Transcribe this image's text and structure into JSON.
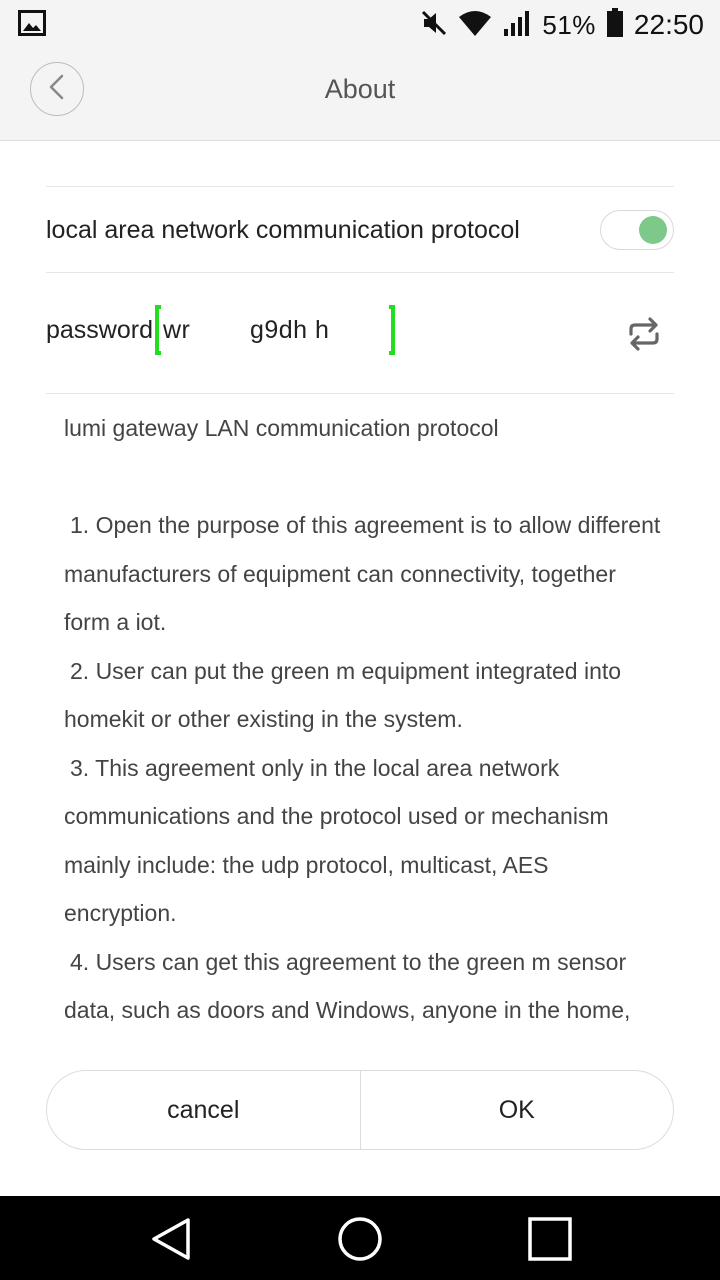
{
  "status_bar": {
    "battery_percent": "51%",
    "time": "22:50",
    "icons": [
      "image-icon",
      "mute-icon",
      "wifi-icon",
      "signal-icon",
      "battery-icon"
    ]
  },
  "header": {
    "title": "About",
    "back_icon": "chevron-left-icon"
  },
  "settings": {
    "lan_protocol_label": "local area network communication protocol",
    "lan_protocol_enabled": true,
    "password_label": "password",
    "password_value": "wr        g9dh h",
    "refresh_icon": "refresh-icon"
  },
  "agreement": {
    "heading": "lumi gateway LAN communication protocol",
    "items": [
      "1. Open the purpose of this agreement is to allow different manufacturers of equipment can connectivity, together form a iot.",
      "2. User can put the green m equipment integrated into homekit or other existing in the system.",
      "3. This agreement only in the local area network communications and the protocol used or mechanism mainly include: the udp protocol, multicast, AES encryption.",
      "4. Users can get this agreement to the green m sensor data, such as doors and Windows, anyone in the home,"
    ]
  },
  "buttons": {
    "cancel": "cancel",
    "ok": "OK"
  },
  "colors": {
    "toggle_on": "#7cc98a",
    "highlight_bracket": "#22dd22",
    "header_bg": "#f4f4f4"
  }
}
